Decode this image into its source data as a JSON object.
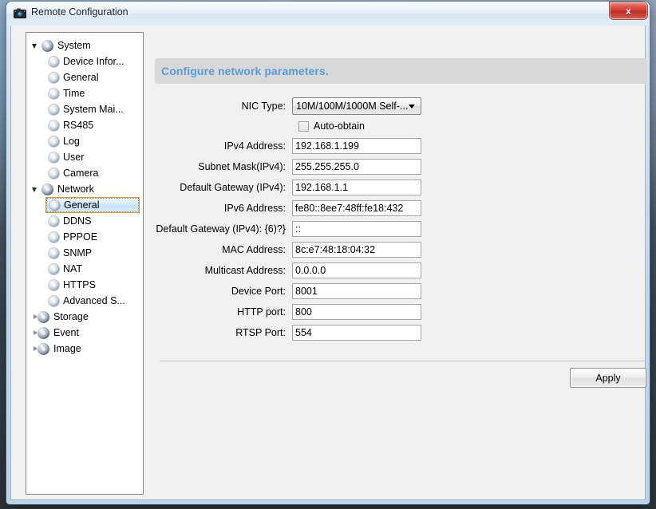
{
  "window": {
    "title": "Remote Configuration",
    "app_icon": "camera-icon",
    "close_label": "x"
  },
  "sidebar": {
    "items": [
      {
        "label": "System",
        "level": "root",
        "expander": "open",
        "icon": "sphere-icon",
        "selected": false
      },
      {
        "label": "Device Infor...",
        "level": "child",
        "expander": "none",
        "icon": "gear-small-icon",
        "selected": false
      },
      {
        "label": "General",
        "level": "child",
        "expander": "none",
        "icon": "gear-small-icon",
        "selected": false
      },
      {
        "label": "Time",
        "level": "child",
        "expander": "none",
        "icon": "gear-small-icon",
        "selected": false
      },
      {
        "label": "System Mai...",
        "level": "child",
        "expander": "none",
        "icon": "gear-small-icon",
        "selected": false
      },
      {
        "label": "RS485",
        "level": "child",
        "expander": "none",
        "icon": "gear-small-icon",
        "selected": false
      },
      {
        "label": "Log",
        "level": "child",
        "expander": "none",
        "icon": "gear-small-icon",
        "selected": false
      },
      {
        "label": "User",
        "level": "child",
        "expander": "none",
        "icon": "gear-small-icon",
        "selected": false
      },
      {
        "label": "Camera",
        "level": "child",
        "expander": "none",
        "icon": "gear-small-icon",
        "selected": false
      },
      {
        "label": "Network",
        "level": "root",
        "expander": "open",
        "icon": "sphere-icon",
        "selected": false
      },
      {
        "label": "General",
        "level": "child",
        "expander": "none",
        "icon": "gear-small-icon",
        "selected": true
      },
      {
        "label": "DDNS",
        "level": "child",
        "expander": "none",
        "icon": "gear-small-icon",
        "selected": false
      },
      {
        "label": "PPPOE",
        "level": "child",
        "expander": "none",
        "icon": "gear-small-icon",
        "selected": false
      },
      {
        "label": "SNMP",
        "level": "child",
        "expander": "none",
        "icon": "gear-small-icon",
        "selected": false
      },
      {
        "label": "NAT",
        "level": "child",
        "expander": "none",
        "icon": "gear-small-icon",
        "selected": false
      },
      {
        "label": "HTTPS",
        "level": "child",
        "expander": "none",
        "icon": "gear-small-icon",
        "selected": false
      },
      {
        "label": "Advanced S...",
        "level": "child",
        "expander": "none",
        "icon": "gear-small-icon",
        "selected": false
      },
      {
        "label": "Storage",
        "level": "root",
        "expander": "closed",
        "icon": "sphere-icon",
        "selected": false
      },
      {
        "label": "Event",
        "level": "root",
        "expander": "closed",
        "icon": "sphere-icon",
        "selected": false
      },
      {
        "label": "Image",
        "level": "root",
        "expander": "closed",
        "icon": "sphere-icon",
        "selected": false
      }
    ]
  },
  "content": {
    "header": "Configure network parameters.",
    "header_color": "#5b9bd5",
    "nic_type": {
      "label": "NIC Type:",
      "value": "10M/100M/1000M Self-..."
    },
    "auto_obtain": {
      "label": "Auto-obtain",
      "checked": false
    },
    "fields": [
      {
        "label": "IPv4 Address:",
        "value": "192.168.1.199"
      },
      {
        "label": "Subnet Mask(IPv4):",
        "value": "255.255.255.0"
      },
      {
        "label": "Default Gateway (IPv4):",
        "value": "192.168.1.1"
      },
      {
        "label": "IPv6 Address:",
        "value": "fe80::8ee7:48ff:fe18:432"
      },
      {
        "label": "Default Gateway (IPv4): {6)?}",
        "value": "::"
      },
      {
        "label": "MAC Address:",
        "value": "8c:e7:48:18:04:32"
      },
      {
        "label": "Multicast Address:",
        "value": "0.0.0.0"
      },
      {
        "label": "Device Port:",
        "value": "8001"
      },
      {
        "label": "HTTP port:",
        "value": "800"
      },
      {
        "label": "RTSP Port:",
        "value": "554"
      }
    ],
    "apply_label": "Apply"
  }
}
